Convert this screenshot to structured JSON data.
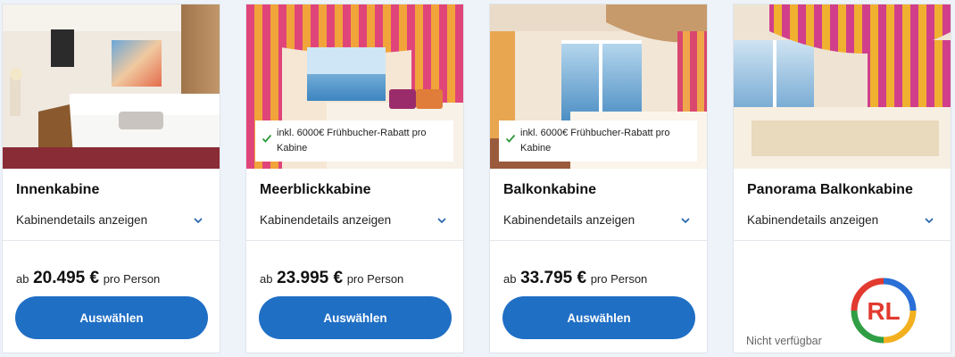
{
  "cards": [
    {
      "title": "Innenkabine",
      "details_label": "Kabinendetails anzeigen",
      "price_prefix": "ab",
      "price_amount": "20.495 €",
      "price_suffix": "pro Person",
      "select_label": "Auswählen"
    },
    {
      "title": "Meerblickkabine",
      "details_label": "Kabinendetails anzeigen",
      "promo_text": "inkl. 6000€ Frühbucher-Rabatt pro Kabine",
      "price_prefix": "ab",
      "price_amount": "23.995 €",
      "price_suffix": "pro Person",
      "select_label": "Auswählen"
    },
    {
      "title": "Balkonkabine",
      "details_label": "Kabinendetails anzeigen",
      "promo_text": "inkl. 6000€ Frühbucher-Rabatt pro Kabine",
      "price_prefix": "ab",
      "price_amount": "33.795 €",
      "price_suffix": "pro Person",
      "select_label": "Auswählen"
    },
    {
      "title": "Panorama Balkonkabine",
      "details_label": "Kabinendetails anzeigen",
      "status_text": "Nicht verfügbar",
      "logo_text": "RL"
    }
  ],
  "icons": {
    "expand": "chevron-down-icon",
    "promo": "check-icon"
  },
  "colors": {
    "button": "#1f6fc5",
    "check": "#2e9a3e",
    "page_bg": "#eef3f9"
  }
}
